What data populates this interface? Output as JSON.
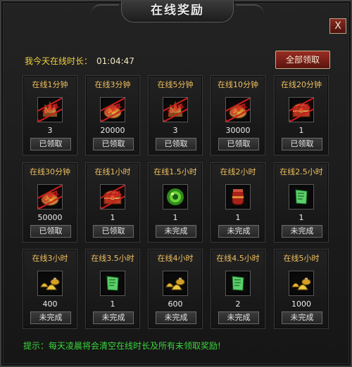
{
  "window": {
    "title": "在线奖励",
    "close_label": "X"
  },
  "header": {
    "online_label": "我今天在线时长：",
    "online_time": "01:04:47",
    "claim_all_label": "全部领取"
  },
  "rewards": [
    {
      "title": "在线1分钟",
      "count": "3",
      "status": "已领取",
      "item": "gold-helmet-icon",
      "claimed": true
    },
    {
      "title": "在线3分钟",
      "count": "20000",
      "status": "已领取",
      "item": "gold-bag-icon",
      "claimed": true
    },
    {
      "title": "在线5分钟",
      "count": "3",
      "status": "已领取",
      "item": "gold-helmet-icon",
      "claimed": true
    },
    {
      "title": "在线10分钟",
      "count": "30000",
      "status": "已领取",
      "item": "gold-bag-icon",
      "claimed": true
    },
    {
      "title": "在线20分钟",
      "count": "1",
      "status": "已领取",
      "item": "treasure-chest-icon",
      "claimed": true
    },
    {
      "title": "在线30分钟",
      "count": "50000",
      "status": "已领取",
      "item": "gold-bag-icon",
      "claimed": true
    },
    {
      "title": "在线1小时",
      "count": "1",
      "status": "已领取",
      "item": "treasure-chest-icon",
      "claimed": true
    },
    {
      "title": "在线1.5小时",
      "count": "1",
      "status": "未完成",
      "item": "green-orb-icon",
      "claimed": false
    },
    {
      "title": "在线2小时",
      "count": "1",
      "status": "未完成",
      "item": "red-jar-icon",
      "claimed": false
    },
    {
      "title": "在线2.5小时",
      "count": "1",
      "status": "未完成",
      "item": "green-scroll-icon",
      "claimed": false
    },
    {
      "title": "在线3小时",
      "count": "400",
      "status": "未完成",
      "item": "gold-ingot-icon",
      "claimed": false
    },
    {
      "title": "在线3.5小时",
      "count": "1",
      "status": "未完成",
      "item": "green-scroll-icon",
      "claimed": false
    },
    {
      "title": "在线4小时",
      "count": "600",
      "status": "未完成",
      "item": "gold-ingot-icon",
      "claimed": false
    },
    {
      "title": "在线4.5小时",
      "count": "2",
      "status": "未完成",
      "item": "green-scroll-icon",
      "claimed": false
    },
    {
      "title": "在线5小时",
      "count": "1000",
      "status": "未完成",
      "item": "gold-ingot-icon",
      "claimed": false
    }
  ],
  "stamp_label": "已领取",
  "tip": "提示：每天凌晨将会清空在线时长及所有未领取奖励!",
  "colors": {
    "title_text": "#f0c060",
    "claim_button": "#9a2d23",
    "tip_text": "#39d63b",
    "stamp": "#d21d1d"
  }
}
